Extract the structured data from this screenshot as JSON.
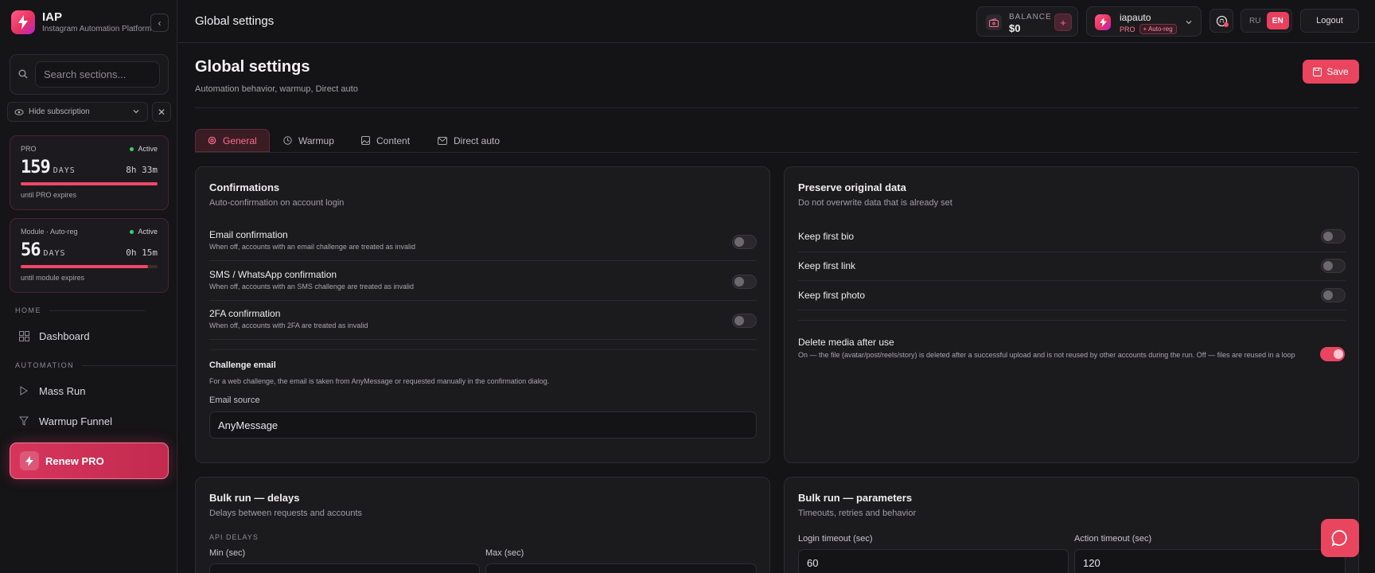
{
  "brand": {
    "title": "IAP",
    "subtitle": "Instagram Automation Platform"
  },
  "sidebar": {
    "search_placeholder": "Search sections...",
    "hide_subscription_label": "Hide subscription",
    "plans": [
      {
        "name": "PRO",
        "status": "Active",
        "days": "159",
        "days_label": "DAYS",
        "time": "8h 33m",
        "progress": 1.0,
        "footer": "until PRO expires"
      },
      {
        "name": "Module · Auto-reg",
        "status": "Active",
        "days": "56",
        "days_label": "DAYS",
        "time": "0h 15m",
        "progress": 0.93,
        "footer": "until module expires"
      }
    ],
    "sections": [
      {
        "label": "HOME",
        "items": [
          {
            "label": "Dashboard",
            "icon": "grid-icon"
          }
        ]
      },
      {
        "label": "AUTOMATION",
        "items": [
          {
            "label": "Mass Run",
            "icon": "play-icon"
          },
          {
            "label": "Warmup Funnel",
            "icon": "funnel-icon"
          }
        ]
      }
    ],
    "renew_label": "Renew PRO"
  },
  "topbar": {
    "title": "Global settings",
    "balance_label": "BALANCE",
    "balance_value": "$0",
    "balance_add": "+",
    "account_name": "iapauto",
    "account_plan": "PRO",
    "account_badge": "+ Auto-reg",
    "lang_ru": "RU",
    "lang_en": "EN",
    "active_lang": "EN",
    "logout_label": "Logout"
  },
  "page": {
    "title": "Global settings",
    "subtitle": "Automation behavior, warmup, Direct auto",
    "save_label": "Save",
    "tabs": [
      {
        "label": "General",
        "icon": "gear-icon",
        "active": true
      },
      {
        "label": "Warmup",
        "icon": "clock-icon",
        "active": false
      },
      {
        "label": "Content",
        "icon": "image-icon",
        "active": false
      },
      {
        "label": "Direct auto",
        "icon": "mail-icon",
        "active": false
      }
    ]
  },
  "confirmations": {
    "title": "Confirmations",
    "subtitle": "Auto-confirmation on account login",
    "items": [
      {
        "label": "Email confirmation",
        "desc": "When off, accounts with an email challenge are treated as invalid",
        "on": false
      },
      {
        "label": "SMS / WhatsApp confirmation",
        "desc": "When off, accounts with an SMS challenge are treated as invalid",
        "on": false
      },
      {
        "label": "2FA confirmation",
        "desc": "When off, accounts with 2FA are treated as invalid",
        "on": false
      }
    ],
    "challenge_title": "Challenge email",
    "challenge_desc": "For a web challenge, the email is taken from AnyMessage or requested manually in the confirmation dialog.",
    "email_source_label": "Email source",
    "email_source_value": "AnyMessage"
  },
  "preserve": {
    "title": "Preserve original data",
    "subtitle": "Do not overwrite data that is already set",
    "items": [
      {
        "label": "Keep first bio",
        "on": false
      },
      {
        "label": "Keep first link",
        "on": false
      },
      {
        "label": "Keep first photo",
        "on": false
      }
    ],
    "delete_label": "Delete media after use",
    "delete_desc": "On — the file (avatar/post/reels/story) is deleted after a successful upload and is not reused by other accounts during the run. Off — files are reused in a loop",
    "delete_on": true
  },
  "bulk_delays": {
    "title": "Bulk run — delays",
    "subtitle": "Delays between requests and accounts",
    "section": "API DELAYS",
    "min_label": "Min (sec)",
    "max_label": "Max (sec)"
  },
  "bulk_params": {
    "title": "Bulk run — parameters",
    "subtitle": "Timeouts, retries and behavior",
    "login_timeout_label": "Login timeout (sec)",
    "login_timeout_value": "60",
    "action_timeout_label": "Action timeout (sec)",
    "action_timeout_value": "120"
  },
  "colors": {
    "accent": "#e9455f",
    "background": "#141316",
    "card": "#1b1a1d",
    "success": "#3ecf6a"
  }
}
